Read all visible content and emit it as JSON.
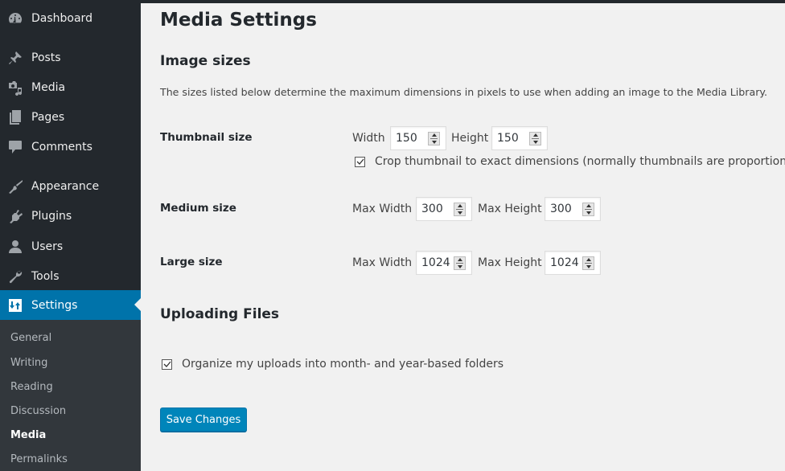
{
  "sidebar": {
    "menu": [
      {
        "label": "Dashboard",
        "icon": "dashboard-icon"
      },
      {
        "label": "Posts",
        "icon": "pin-icon"
      },
      {
        "label": "Media",
        "icon": "media-icon"
      },
      {
        "label": "Pages",
        "icon": "pages-icon"
      },
      {
        "label": "Comments",
        "icon": "comment-icon"
      },
      {
        "label": "Appearance",
        "icon": "paintbrush-icon"
      },
      {
        "label": "Plugins",
        "icon": "plugin-icon"
      },
      {
        "label": "Users",
        "icon": "user-icon"
      },
      {
        "label": "Tools",
        "icon": "wrench-icon"
      },
      {
        "label": "Settings",
        "icon": "settings-icon",
        "active": true
      }
    ],
    "submenu": [
      {
        "label": "General"
      },
      {
        "label": "Writing"
      },
      {
        "label": "Reading"
      },
      {
        "label": "Discussion"
      },
      {
        "label": "Media",
        "current": true
      },
      {
        "label": "Permalinks"
      }
    ]
  },
  "page": {
    "title": "Media Settings",
    "image_sizes": {
      "heading": "Image sizes",
      "description": "The sizes listed below determine the maximum dimensions in pixels to use when adding an image to the Media Library.",
      "thumbnail": {
        "label": "Thumbnail size",
        "width_label": "Width",
        "width_value": "150",
        "height_label": "Height",
        "height_value": "150",
        "crop_label": "Crop thumbnail to exact dimensions (normally thumbnails are proportional)",
        "crop_checked": true
      },
      "medium": {
        "label": "Medium size",
        "width_label": "Max Width",
        "width_value": "300",
        "height_label": "Max Height",
        "height_value": "300"
      },
      "large": {
        "label": "Large size",
        "width_label": "Max Width",
        "width_value": "1024",
        "height_label": "Max Height",
        "height_value": "1024"
      }
    },
    "uploading": {
      "heading": "Uploading Files",
      "organize_label": "Organize my uploads into month- and year-based folders",
      "organize_checked": true
    },
    "save_label": "Save Changes"
  },
  "colors": {
    "sidebar_bg": "#23282d",
    "submenu_bg": "#32373c",
    "accent": "#0073aa",
    "button": "#0085ba",
    "page_bg": "#f1f1f1"
  }
}
